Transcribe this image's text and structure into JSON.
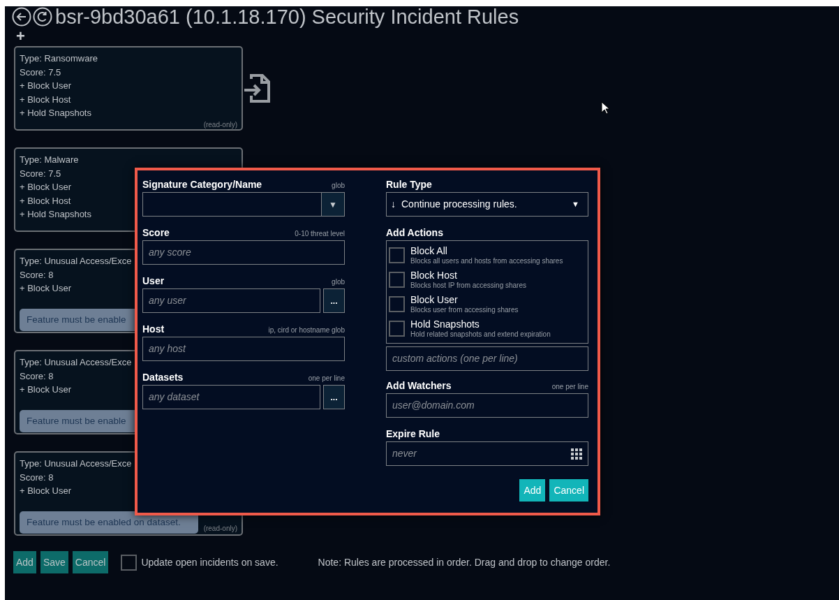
{
  "header": {
    "title": "bsr-9bd30a61 (10.1.18.170) Security Incident Rules",
    "add_symbol": "+"
  },
  "rules": [
    {
      "lines": [
        "Type: Ransomware",
        "Score: 7.5",
        "+ Block User",
        "+ Block Host",
        "+ Hold Snapshots"
      ],
      "read_only_label": "(read-only)",
      "import_icon": true
    },
    {
      "lines": [
        "Type: Malware",
        "Score: 7.5",
        "+ Block User",
        "+ Block Host",
        "+ Hold Snapshots"
      ]
    },
    {
      "lines": [
        "Type: Unusual Access/Exce",
        "Score: 8",
        "+ Block User"
      ],
      "notice": "Feature must be enable"
    },
    {
      "lines": [
        "Type: Unusual Access/Exce",
        "Score: 8",
        "+ Block User"
      ],
      "notice": "Feature must be enable"
    },
    {
      "lines": [
        "Type: Unusual Access/Exce",
        "Score: 8",
        "+ Block User"
      ],
      "notice": "Feature must be enabled on dataset.",
      "read_only_label": "(read-only)"
    }
  ],
  "footer": {
    "buttons": [
      "Add",
      "Save",
      "Cancel"
    ],
    "update_checkbox": {
      "label": "Update open incidents on save.",
      "checked": false
    },
    "note": "Note: Rules are processed in order. Drag and drop to change order."
  },
  "dialog": {
    "left": [
      {
        "kind": "select",
        "label": "Signature Category/Name",
        "hint": "glob",
        "arrow": "▼"
      },
      {
        "kind": "text",
        "label": "Score",
        "hint": "0-10 threat level",
        "placeholder": "any score"
      },
      {
        "kind": "browse",
        "label": "User",
        "hint": "glob",
        "placeholder": "any user",
        "button": "..."
      },
      {
        "kind": "text",
        "label": "Host",
        "hint": "ip, cird or hostname glob",
        "placeholder": "any host"
      },
      {
        "kind": "browse",
        "label": "Datasets",
        "hint": "one per line",
        "placeholder": "any dataset",
        "button": "..."
      }
    ],
    "rule_type": {
      "label": "Rule Type",
      "symbol": "↓",
      "value": "Continue processing rules.",
      "arrow": "▼"
    },
    "actions": {
      "label": "Add Actions",
      "items": [
        {
          "title": "Block All",
          "description": "Blocks all users and hosts from accessing shares",
          "checked": false
        },
        {
          "title": "Block Host",
          "description": "Blocks host IP from accessing shares",
          "checked": false
        },
        {
          "title": "Block User",
          "description": "Blocks user from accessing shares",
          "checked": false
        },
        {
          "title": "Hold Snapshots",
          "description": "Hold related snapshots and extend expiration",
          "checked": false
        }
      ],
      "custom_placeholder": "custom actions (one per line)"
    },
    "watchers": {
      "label": "Add Watchers",
      "hint": "one per line",
      "placeholder": "user@domain.com"
    },
    "expire": {
      "label": "Expire Rule",
      "placeholder": "never"
    },
    "buttons": [
      "Add",
      "Cancel"
    ]
  }
}
